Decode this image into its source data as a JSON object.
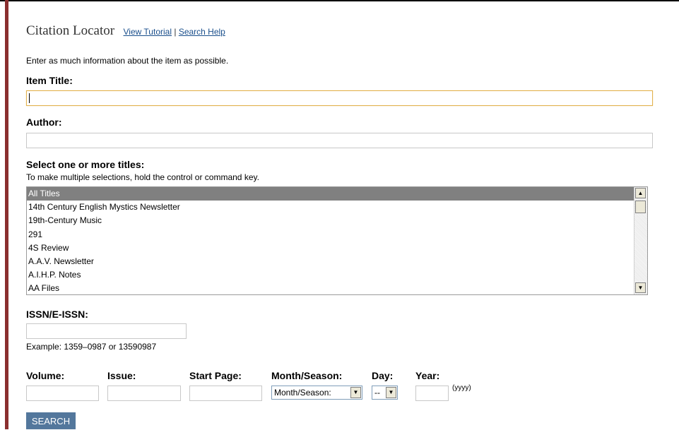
{
  "header": {
    "title": "Citation Locator",
    "tutorial_link": "View Tutorial",
    "separator": "|",
    "help_link": "Search Help"
  },
  "intro": "Enter as much information about the item as possible.",
  "item_title": {
    "label": "Item Title:",
    "value": ""
  },
  "author": {
    "label": "Author:",
    "value": ""
  },
  "titles": {
    "label": "Select one or more titles:",
    "hint": "To make multiple selections, hold the control or command key.",
    "options": [
      "All Titles",
      "14th Century English Mystics Newsletter",
      "19th-Century Music",
      "291",
      "4S Review",
      "A.A.V. Newsletter",
      "A.I.H.P. Notes",
      "AA Files"
    ],
    "selected": "All Titles"
  },
  "issn": {
    "label": "ISSN/E-ISSN:",
    "value": "",
    "example": "Example: 1359–0987 or 13590987"
  },
  "volume": {
    "label": "Volume:",
    "value": ""
  },
  "issue": {
    "label": "Issue:",
    "value": ""
  },
  "start_page": {
    "label": "Start Page:",
    "value": ""
  },
  "month": {
    "label": "Month/Season:",
    "selected": "Month/Season:"
  },
  "day": {
    "label": "Day:",
    "selected": "--"
  },
  "year": {
    "label": "Year:",
    "value": "",
    "format_hint": "(yyyy)"
  },
  "search_button": "SEARCH",
  "colors": {
    "left_bar": "#8a2f2f",
    "link": "#1a4f8c",
    "button": "#53779c",
    "selected_option": "#808080"
  }
}
